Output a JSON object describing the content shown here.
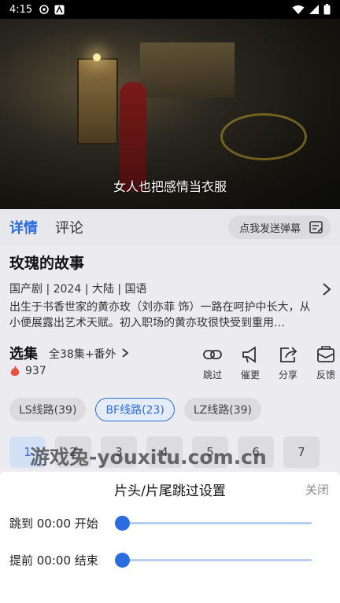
{
  "status_bar": {
    "time": "4:15"
  },
  "video": {
    "subtitle": "女人也把感情当衣服"
  },
  "tabs": [
    {
      "label": "详情"
    },
    {
      "label": "评论"
    }
  ],
  "danmu": {
    "label": "点我发送弹幕"
  },
  "show": {
    "title": "玫瑰的故事",
    "meta": "国产剧 | 2024 | 大陆 | 国语",
    "description": "出生于书香世家的黄亦玫（刘亦菲 饰）一路在呵护中长大，从小便展露出艺术天赋。初入职场的黄亦玫很快受到重用…"
  },
  "episodes": {
    "title": "选集",
    "count": "全38集+番外",
    "hot": "937",
    "actions": [
      {
        "label": "跳过"
      },
      {
        "label": "催更"
      },
      {
        "label": "分享"
      },
      {
        "label": "反馈"
      }
    ],
    "routes": [
      {
        "label": "LS线路(39)"
      },
      {
        "label": "BF线路(23)"
      },
      {
        "label": "LZ线路(39)"
      }
    ],
    "numbers": [
      "1",
      "2",
      "3",
      "4",
      "5",
      "6",
      "7"
    ]
  },
  "watermark": "游戏兔-youxitu.com.cn",
  "skip_sheet": {
    "title": "片头/片尾跳过设置",
    "close_label": "关闭",
    "intro_label": "跳到 00:00 开始",
    "outro_label": "提前 00:00 结束",
    "intro_level": 0,
    "outro_level": 0
  },
  "colors": {
    "accent": "#2a6de0"
  }
}
